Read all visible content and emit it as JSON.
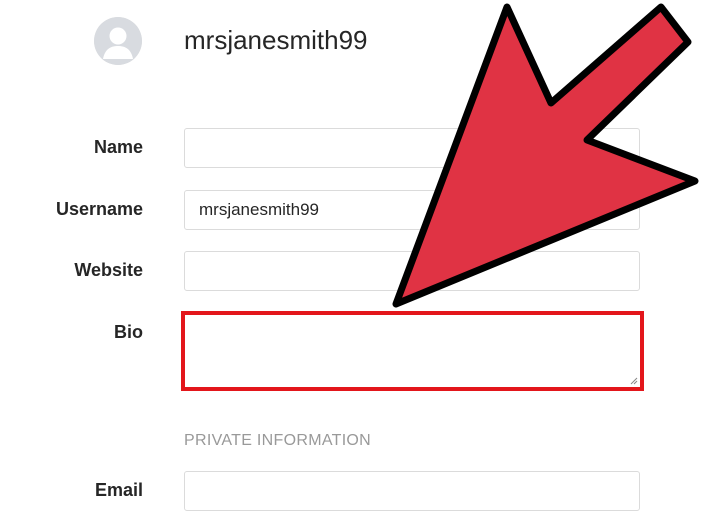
{
  "profile": {
    "username": "mrsjanesmith99"
  },
  "form": {
    "name_label": "Name",
    "name_value": "",
    "username_label": "Username",
    "username_value": "mrsjanesmith99",
    "website_label": "Website",
    "website_value": "",
    "bio_label": "Bio",
    "bio_value": "",
    "private_heading": "PRIVATE INFORMATION",
    "email_label": "Email",
    "email_value": ""
  },
  "colors": {
    "highlight_border": "#e3161b",
    "arrow_fill": "#e03344",
    "arrow_outline": "#000000"
  },
  "icons": {
    "avatar": "default-user-avatar-icon",
    "pointer": "red-arrow-annotation-icon"
  }
}
